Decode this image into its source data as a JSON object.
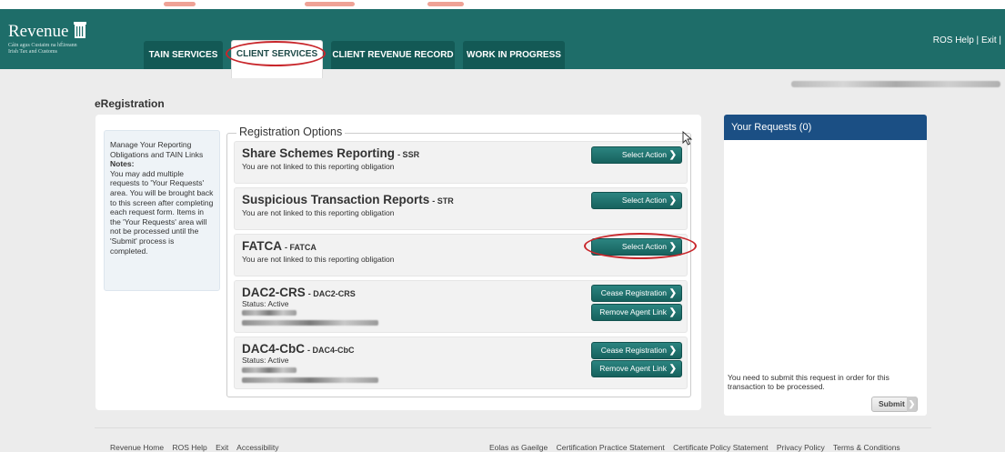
{
  "header": {
    "logo": {
      "word": "Revenue",
      "subtitle_line1": "Cáin agus Custaim na hÉireann",
      "subtitle_line2": "Irish Tax and Customs"
    },
    "tabs": [
      {
        "label": "TAIN SERVICES"
      },
      {
        "label": "CLIENT SERVICES"
      },
      {
        "label": "CLIENT REVENUE RECORD"
      },
      {
        "label": "WORK IN PROGRESS"
      }
    ],
    "active_tab": "CLIENT SERVICES",
    "links": {
      "help": "ROS Help",
      "separator": "|",
      "exit": "Exit",
      "trailing": "|"
    }
  },
  "page": {
    "title": "eRegistration"
  },
  "notes": {
    "line1": "Manage Your Reporting Obligations and TAIN Links",
    "heading": "Notes:",
    "text": "You may add multiple requests to 'Your Requests' area. You will be brought back to this screen after completing each request form. Items in the 'Your Requests' area will not be processed until the 'Submit' process is completed."
  },
  "registration": {
    "legend": "Registration Options",
    "options": [
      {
        "title": "Share Schemes Reporting",
        "code": "- SSR",
        "line": "You are not linked to this reporting obligation",
        "button": "Select Action"
      },
      {
        "title": "Suspicious Transaction Reports",
        "code": "- STR",
        "line": "You are not linked to this reporting obligation",
        "button": "Select Action"
      },
      {
        "title": "FATCA",
        "code": "- FATCA",
        "line": "You are not linked to this reporting obligation",
        "button": "Select Action"
      },
      {
        "title": "DAC2-CRS",
        "code": "- DAC2-CRS",
        "status": "Status: Active",
        "button1": "Cease Registration",
        "button2": "Remove Agent Link"
      },
      {
        "title": "DAC4-CbC",
        "code": "- DAC4-CbC",
        "status": "Status: Active",
        "button1": "Cease Registration",
        "button2": "Remove Agent Link"
      }
    ]
  },
  "requests": {
    "title": "Your Requests (0)",
    "note": "You need to submit this request in order for this transaction to be processed.",
    "submit": "Submit"
  },
  "footer": {
    "left": [
      "Revenue Home",
      "ROS Help",
      "Exit",
      "Accessibility"
    ],
    "right": [
      "Eolas as Gaeilge",
      "Certification Practice Statement",
      "Certificate Policy Statement",
      "Privacy Policy",
      "Terms & Conditions"
    ]
  },
  "colors": {
    "header": "#1e6d69",
    "tab": "#135955",
    "button": "#1f6e6a",
    "requests_header": "#1b4f84",
    "highlight": "#c8262b"
  },
  "icons": [
    "harp-icon",
    "chevron-right-icon",
    "mouse-cursor-icon"
  ]
}
